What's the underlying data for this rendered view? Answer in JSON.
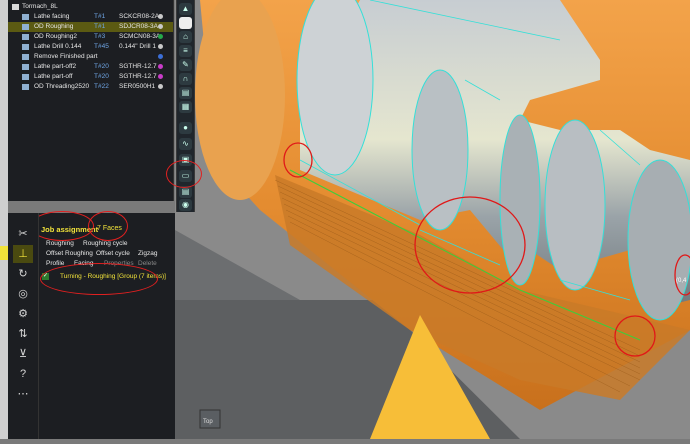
{
  "operations_panel": {
    "root": "Tormach_8L",
    "rows": [
      {
        "name": "Lathe facing",
        "tool": "T#1",
        "toolname": "SCKCR08-2A",
        "status": "#c9c9c9"
      },
      {
        "name": "OD Roughing",
        "tool": "T#1",
        "toolname": "SDJCR08-3A",
        "status": "#c9c9c9",
        "selected": true
      },
      {
        "name": "OD Roughing2",
        "tool": "T#3",
        "toolname": "SCMCN08-3A",
        "status": "#26a84a"
      },
      {
        "name": "Lathe Drill 0.144",
        "tool": "T#45",
        "toolname": "0.144\" Drill 1",
        "status": "#c9c9c9"
      },
      {
        "name": "Remove Finished part",
        "tool": "",
        "toolname": "",
        "status": "#3b6ed6"
      },
      {
        "name": "Lathe part-off2",
        "tool": "T#20",
        "toolname": "SGTHR-12.7",
        "status": "#c83cc8"
      },
      {
        "name": "Lathe part-off",
        "tool": "T#20",
        "toolname": "SGTHR-12.7",
        "status": "#c83cc8"
      },
      {
        "name": "OD Threading2520",
        "tool": "T#22",
        "toolname": "SER0500H1",
        "status": "#c9c9c9"
      }
    ]
  },
  "job_panel": {
    "title": "Job assignment",
    "faces": "7 Faces",
    "tools": [
      {
        "label": "Roughing"
      },
      {
        "label": "Roughing cycle"
      },
      {
        "label": "Offset Roughing"
      },
      {
        "label": "Offset cycle"
      },
      {
        "label": "Zigzag"
      },
      {
        "label": "Profile"
      },
      {
        "label": "Facing"
      },
      {
        "label": "Properties"
      },
      {
        "label": "Delete"
      }
    ],
    "assignment": "Turning - Roughing [Group (7 items)]"
  },
  "viewcube": {
    "label": "Top"
  },
  "corner_text": "(0,4"
}
